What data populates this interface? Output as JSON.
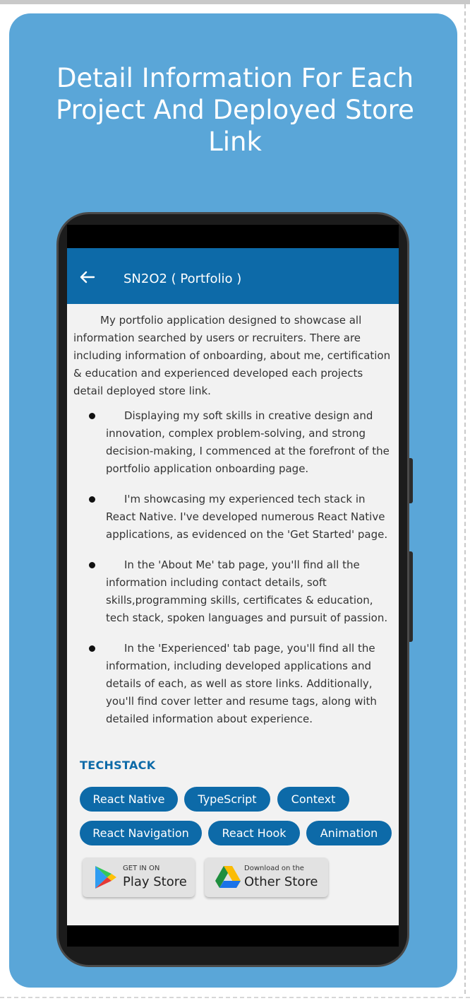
{
  "headline": "Detail Information For Each Project And Deployed Store Link",
  "appbar": {
    "title": "SN2O2 ( Portfolio )"
  },
  "intro": "My portfolio application designed to showcase all information searched by users or recruiters. There are including information of onboarding, about me, certification & education and experienced developed each projects detail deployed store link.",
  "bullets": [
    "Displaying my soft skills in creative design and innovation, complex problem-solving, and strong decision-making, I commenced at the forefront of the portfolio application onboarding page.",
    "I'm showcasing my experienced tech stack in React Native. I've developed numerous React Native applications, as evidenced on the 'Get Started' page.",
    "In the 'About Me' tab page, you'll find all the information including contact details, soft skills,programming skills, certificates & education, tech stack, spoken languages and pursuit of passion.",
    "In the 'Experienced' tab page, you'll find all the information, including developed applications and details of each, as well as store links. Additionally, you'll find cover letter and resume tags, along with detailed information about experience."
  ],
  "techstack": {
    "title": "TECHSTACK",
    "tags": [
      "React Native",
      "TypeScript",
      "Context",
      "React Navigation",
      "React Hook",
      "Animation"
    ]
  },
  "stores": {
    "play": {
      "small": "GET IN ON",
      "big": "Play Store"
    },
    "other": {
      "small": "Download on the",
      "big": "Other Store"
    }
  },
  "colors": {
    "card": "#5aa6d8",
    "appbar": "#0d6aa8",
    "tag": "#0d6aa8"
  }
}
